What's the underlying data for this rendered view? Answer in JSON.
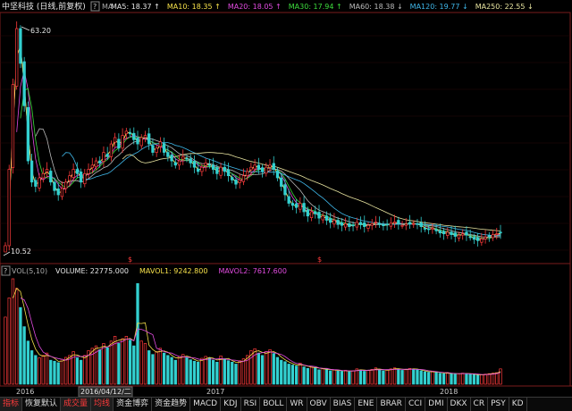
{
  "header": {
    "title": "中坚科技 (日线,前复权)",
    "help": "?",
    "ind": "MA",
    "ma": [
      {
        "label": "MA5: 18.37",
        "arrow": "↑",
        "color": "#e6e6e6"
      },
      {
        "label": "MA10: 18.35",
        "arrow": "↑",
        "color": "#f5e04a"
      },
      {
        "label": "MA20: 18.05",
        "arrow": "↑",
        "color": "#e24be0"
      },
      {
        "label": "MA30: 17.94",
        "arrow": "↑",
        "color": "#3ddc3d"
      },
      {
        "label": "MA60: 18.38",
        "arrow": "↓",
        "color": "#bbbbbb"
      },
      {
        "label": "MA120: 19.77",
        "arrow": "↓",
        "color": "#3fb6e8"
      },
      {
        "label": "MA250: 22.55",
        "arrow": "↓",
        "color": "#e8e4a0"
      }
    ]
  },
  "price": {
    "high_label": "63.20",
    "low_label": "10.52",
    "markers": [
      "$",
      "$"
    ]
  },
  "volume": {
    "help": "?",
    "title": "VOL(5,10)",
    "items": [
      {
        "label": "VOLUME: 22775.000",
        "color": "#e6e6e6"
      },
      {
        "label": "MAVOL1: 9242.800",
        "color": "#f5e04a"
      },
      {
        "label": "MAVOL2: 7617.600",
        "color": "#e24be0"
      }
    ]
  },
  "time_axis": [
    "2016",
    "2016/04/12/二",
    "2017",
    "2018"
  ],
  "tabs": [
    "指标",
    "恢复默认",
    "成交量",
    "均线",
    "资金博弈",
    "资金趋势",
    "MACD",
    "KDJ",
    "RSI",
    "BOLL",
    "WR",
    "OBV",
    "BIAS",
    "ENE",
    "BRAR",
    "CCI",
    "DMI",
    "DKX",
    "CR",
    "PSY",
    "KD"
  ],
  "active_tabs": [
    "指标",
    "成交量",
    "均线"
  ],
  "colors": {
    "up": "#ff3b3b",
    "down": "#33d0d0",
    "background": "#000000",
    "border": "#8a2020"
  },
  "chart_data": {
    "type": "candlestick",
    "price_range": [
      10.52,
      63.2
    ],
    "close": [
      12.0,
      30.0,
      50.0,
      63.2,
      55.0,
      45.0,
      32.0,
      27.0,
      26.0,
      28.0,
      29.0,
      30.0,
      27.0,
      25.0,
      24.0,
      25.5,
      27.0,
      28.5,
      30.0,
      29.0,
      27.0,
      29.0,
      30.0,
      31.0,
      32.0,
      31.5,
      34.0,
      33.0,
      36.0,
      37.5,
      35.0,
      38.0,
      39.0,
      38.5,
      37.0,
      36.0,
      37.5,
      38.0,
      36.0,
      34.0,
      35.0,
      36.5,
      34.0,
      33.0,
      32.0,
      31.0,
      32.0,
      33.0,
      32.5,
      31.5,
      30.5,
      29.5,
      30.5,
      31.5,
      31.0,
      30.0,
      29.0,
      30.5,
      29.5,
      28.5,
      27.5,
      26.5,
      27.5,
      28.5,
      29.5,
      30.5,
      31.0,
      30.0,
      29.5,
      30.5,
      31.0,
      30.0,
      28.0,
      26.0,
      24.0,
      22.0,
      21.5,
      21.0,
      22.0,
      20.0,
      19.0,
      20.0,
      19.5,
      18.5,
      19.0,
      18.0,
      17.5,
      18.0,
      17.0,
      16.8,
      17.2,
      16.5,
      16.8,
      17.5,
      17.0,
      16.5,
      16.8,
      17.2,
      17.6,
      17.0,
      16.7,
      17.0,
      17.3,
      17.6,
      17.2,
      16.8,
      17.1,
      17.4,
      17.2,
      17.0,
      16.5,
      16.0,
      15.8,
      16.2,
      15.5,
      15.0,
      14.8,
      15.2,
      14.6,
      14.2,
      14.5,
      14.8,
      14.5,
      14.0,
      13.5,
      13.2,
      13.6,
      14.0,
      14.3,
      14.6,
      14.8,
      15.0
    ],
    "volume": [
      14000,
      18000,
      22000,
      20000,
      16000,
      12000,
      9000,
      7000,
      6000,
      5500,
      6000,
      6500,
      5000,
      4800,
      4500,
      5200,
      5600,
      6000,
      6800,
      5500,
      5000,
      6000,
      7000,
      7500,
      8000,
      7200,
      8500,
      7600,
      9000,
      10000,
      8500,
      9500,
      10000,
      9200,
      8000,
      21000,
      9000,
      8500,
      7000,
      6200,
      6800,
      7500,
      6500,
      6000,
      5600,
      5000,
      5800,
      6200,
      5600,
      5100,
      4800,
      4600,
      5400,
      5800,
      5500,
      5000,
      4600,
      5900,
      5300,
      4900,
      4600,
      4200,
      4900,
      5300,
      6000,
      7000,
      7400,
      6500,
      6000,
      6800,
      7200,
      6400,
      5600,
      5000,
      4700,
      4200,
      4000,
      3800,
      4400,
      3600,
      3300,
      3700,
      3400,
      3000,
      3300,
      3100,
      2800,
      3000,
      2800,
      2700,
      2900,
      2600,
      2800,
      3200,
      3000,
      2700,
      2900,
      3100,
      3400,
      3000,
      2800,
      3000,
      3200,
      3400,
      3100,
      2900,
      3100,
      3300,
      3200,
      3000,
      2800,
      2600,
      2500,
      2700,
      2500,
      2300,
      2200,
      2400,
      2200,
      2100,
      2200,
      2300,
      2200,
      2100,
      2000,
      1900,
      2000,
      2100,
      2200,
      2300,
      2400,
      3200
    ]
  }
}
